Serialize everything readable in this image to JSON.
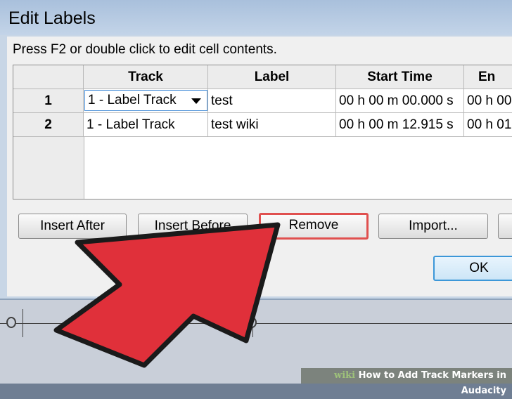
{
  "window": {
    "title": "Edit Labels"
  },
  "instructions": "Press F2 or double click to edit cell contents.",
  "table": {
    "columns": [
      "Track",
      "Label",
      "Start Time",
      "En"
    ],
    "rows": [
      {
        "num": "1",
        "track": "1 - Label Track",
        "label": "test",
        "start": "00 h 00 m 00.000 s",
        "end": "00 h 00"
      },
      {
        "num": "2",
        "track": "1 - Label Track",
        "label": "test wiki",
        "start": "00 h 00 m 12.915 s",
        "end": "00 h 01"
      }
    ]
  },
  "buttons": {
    "insert_after": "Insert After",
    "insert_before": "Insert Before",
    "remove": "Remove",
    "import": "Import...",
    "ok": "OK"
  },
  "banner": {
    "brand": "wiki",
    "text": "How to Add Track Markers in Audacity"
  },
  "colors": {
    "highlight": "#e0504f",
    "arrow": "#e0303a",
    "ok_border": "#3c97d8"
  }
}
